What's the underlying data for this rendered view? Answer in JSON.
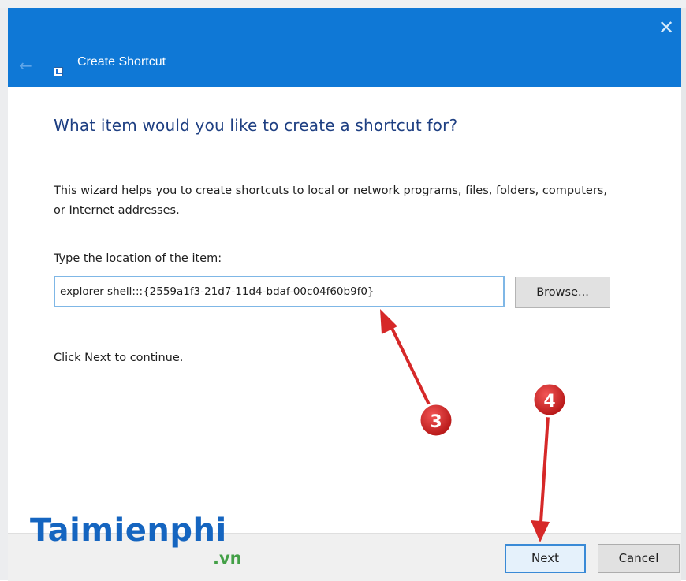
{
  "window": {
    "title": "Create Shortcut",
    "close_glyph": "✕",
    "back_glyph": "←",
    "accent_color": "#0f78d6"
  },
  "main": {
    "heading": "What item would you like to create a shortcut for?",
    "description": "This wizard helps you to create shortcuts to local or network programs, files, folders, computers, or Internet addresses.",
    "location_label": "Type the location of the item:",
    "location_value": "explorer shell:::{2559a1f3-21d7-11d4-bdaf-00c04f60b9f0}",
    "browse_label": "Browse...",
    "continue_text": "Click Next to continue."
  },
  "footer": {
    "next_label": "Next",
    "cancel_label": "Cancel"
  },
  "annotations": {
    "step_input": "3",
    "step_next": "4",
    "marker_color": "#d62828"
  },
  "watermark": {
    "main": "Taimienphi",
    "sub": ".vn"
  }
}
